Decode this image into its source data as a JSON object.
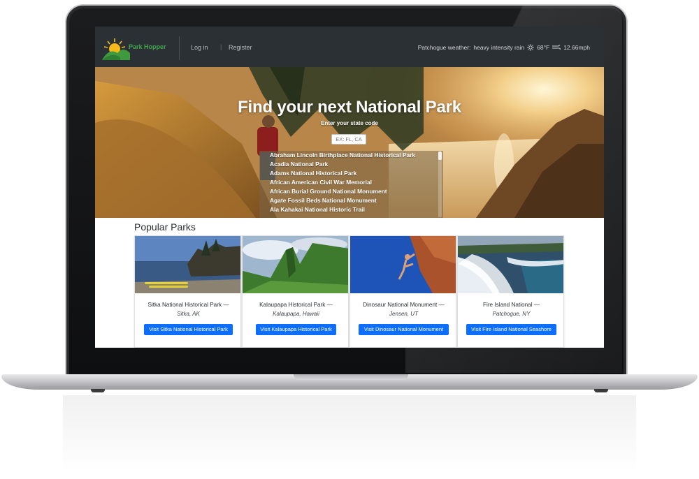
{
  "navbar": {
    "brand": "Park Hopper",
    "login_label": "Log in",
    "register_label": "Register",
    "separator": "|",
    "weather": {
      "label": "Patchogue weather:",
      "condition": "heavy intensity rain",
      "temperature": "68°F",
      "wind": "12.66mph",
      "temp_icon": "sun-icon",
      "wind_icon": "wind-icon"
    }
  },
  "hero": {
    "title": "Find your next National Park",
    "subtitle": "Enter your state code",
    "state_input_placeholder": "EX: FL, CA",
    "park_options": [
      "Abraham Lincoln Birthplace National Historical Park",
      "Acadia National Park",
      "Adams National Historical Park",
      "African American Civil War Memorial",
      "African Burial Ground National Monument",
      "Agate Fossil Beds National Monument",
      "Ala Kahakai National Historic Trail"
    ]
  },
  "popular": {
    "heading": "Popular Parks",
    "cards": [
      {
        "title": "Sitka National Historical Park —",
        "location": "Sitka, AK",
        "button": "Visit Sitka National Historical Park"
      },
      {
        "title": "Kalaupapa Historical Park —",
        "location": "Kalaupapa, Hawaii",
        "button": "Visit Kalaupapa Historical Park"
      },
      {
        "title": "Dinosaur National Monument —",
        "location": "Jensen, UT",
        "button": "Visit Dinosaur National Monument"
      },
      {
        "title": "Fire Island National —",
        "location": "Patchogue, NY",
        "button": "Visit Fire Island National Seashore"
      }
    ]
  },
  "colors": {
    "navbar_bg": "#2b3035",
    "brand_green": "#3fa64a",
    "button_blue": "#0d6efd"
  }
}
